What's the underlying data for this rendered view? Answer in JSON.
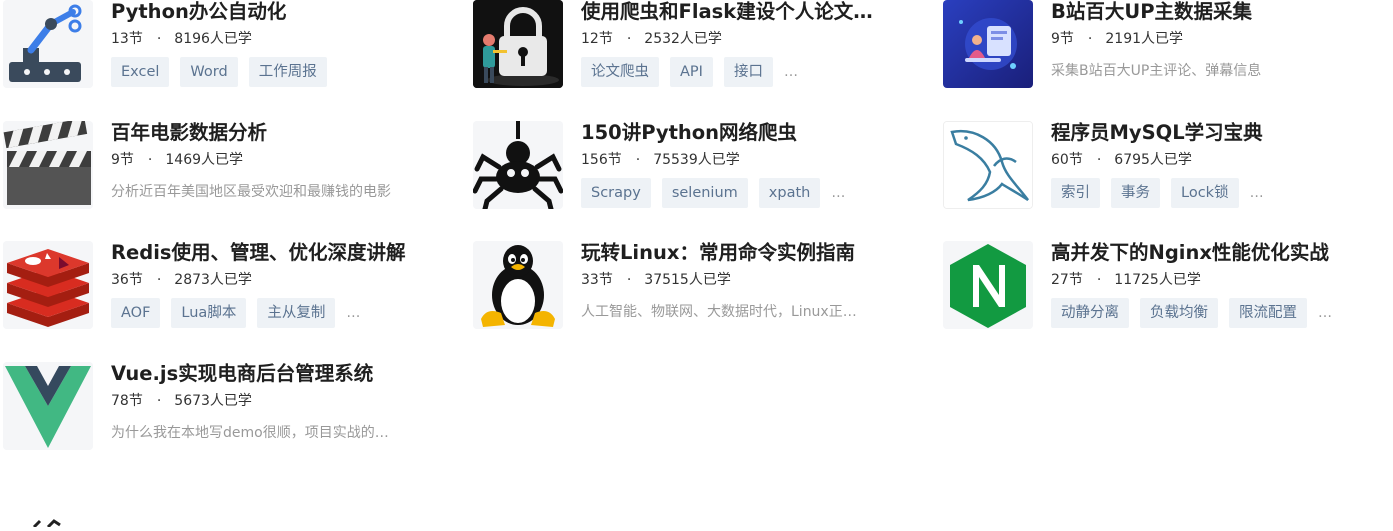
{
  "courses": [
    {
      "title": "Python办公自动化",
      "lessons": "13节",
      "learners": "8196人已学",
      "tags": [
        "Excel",
        "Word",
        "工作周报"
      ],
      "more": "",
      "desc": ""
    },
    {
      "title": "使用爬虫和Flask建设个人论文…",
      "lessons": "12节",
      "learners": "2532人已学",
      "tags": [
        "论文爬虫",
        "API",
        "接口"
      ],
      "more": "…",
      "desc": ""
    },
    {
      "title": "B站百大UP主数据采集",
      "lessons": "9节",
      "learners": "2191人已学",
      "tags": [],
      "more": "",
      "desc": "采集B站百大UP主评论、弹幕信息"
    },
    {
      "title": "百年电影数据分析",
      "lessons": "9节",
      "learners": "1469人已学",
      "tags": [],
      "more": "",
      "desc": "分析近百年美国地区最受欢迎和最赚钱的电影"
    },
    {
      "title": "150讲Python网络爬虫",
      "lessons": "156节",
      "learners": "75539人已学",
      "tags": [
        "Scrapy",
        "selenium",
        "xpath"
      ],
      "more": "…",
      "desc": ""
    },
    {
      "title": "程序员MySQL学习宝典",
      "lessons": "60节",
      "learners": "6795人已学",
      "tags": [
        "索引",
        "事务",
        "Lock锁"
      ],
      "more": "…",
      "desc": ""
    },
    {
      "title": "Redis使用、管理、优化深度讲解",
      "lessons": "36节",
      "learners": "2873人已学",
      "tags": [
        "AOF",
        "Lua脚本",
        "主从复制"
      ],
      "more": "…",
      "desc": ""
    },
    {
      "title": "玩转Linux：常用命令实例指南",
      "lessons": "33节",
      "learners": "37515人已学",
      "tags": [],
      "more": "",
      "desc": "人工智能、物联网、大数据时代，Linux正…"
    },
    {
      "title": "高并发下的Nginx性能优化实战",
      "lessons": "27节",
      "learners": "11725人已学",
      "tags": [
        "动静分离",
        "负载均衡",
        "限流配置"
      ],
      "more": "…",
      "desc": ""
    },
    {
      "title": "Vue.js实现电商后台管理系统",
      "lessons": "78节",
      "learners": "5673人已学",
      "tags": [],
      "more": "",
      "desc": "为什么我在本地写demo很顺，项目实战的…"
    }
  ],
  "separator": "·"
}
